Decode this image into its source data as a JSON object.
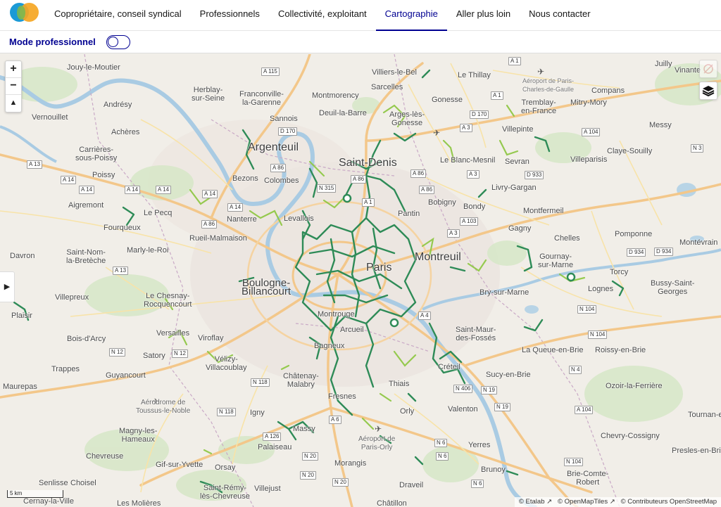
{
  "nav": {
    "items": [
      "Copropriétaire, conseil syndical",
      "Professionnels",
      "Collectivité, exploitant",
      "Cartographie",
      "Aller plus loin",
      "Nous contacter"
    ],
    "active": "Cartographie"
  },
  "mode": {
    "label": "Mode professionnel",
    "enabled": false
  },
  "colors": {
    "accent": "#000091",
    "network_dark": "#2e8b57",
    "network_light": "#8cc63f"
  },
  "map": {
    "zoom_in": "+",
    "zoom_out": "−",
    "north": "▲",
    "scale": "5 km",
    "attribution": [
      "© Etalab",
      "© OpenMapTiles",
      "© Contributeurs OpenStreetMap"
    ],
    "places": {
      "jouy": "Jouy-le-Moutier",
      "herblay": "Herblay-\nsur-Seine",
      "franconville": "Franconville-\nla-Garenne",
      "montmorency": "Montmorency",
      "villiers_bel": "Villiers-le-Bel",
      "thillay": "Le Thillay",
      "sarcelles": "Sarcelles",
      "gonesse": "Gonesse",
      "roissy_cdg": "Aéroport de Paris-\nCharles-de-Gaulle",
      "jully": "Juilly",
      "vinantes": "Vinante",
      "andresy": "Andrésy",
      "sannois": "Sannois",
      "deuil": "Deuil-la-Barre",
      "arnouville": "Arges-lès-\nGonesse",
      "tremblay": "Tremblay-\nen-France",
      "mitry": "Mitry-Mory",
      "compans": "Compans",
      "vernouillet": "Vernouillet",
      "acheres": "Achères",
      "messy": "Messy",
      "carrieres": "Carrières-\nsous-Poissy",
      "argenteuil": "Argenteuil",
      "villepinte": "Villepinte",
      "claye": "Claye-Souilly",
      "saint_denis": "Saint-Denis",
      "blanc_mesnil": "Le Blanc-Mesnil",
      "sevran": "Sevran",
      "villeparisis": "Villeparisis",
      "poissy": "Poissy",
      "bezons": "Bezons",
      "colombes": "Colombes",
      "livry": "Livry-Gargan",
      "aigremont": "Aigremont",
      "le_pecq": "Le Pecq",
      "bobigny": "Bobigny",
      "bondy": "Bondy",
      "montfermeil": "Montfermeil",
      "nanterre": "Nanterre",
      "levallois": "Levallois",
      "pantin": "Pantin",
      "fourqueux": "Fourqueux",
      "rueil": "Rueil-Malmaison",
      "gagny": "Gagny",
      "pomponne": "Pomponne",
      "chelles": "Chelles",
      "montevrain": "Montévrain",
      "davron": "Davron",
      "saint_nom": "Saint-Nom-\nla-Bretèche",
      "marly": "Marly-le-Roi",
      "paris": "Paris",
      "montreuil": "Montreuil",
      "gournay": "Gournay-\nsur-Marne",
      "torcy": "Torcy",
      "boulogne": "Boulogne-\nBillancourt",
      "chesnay": "Le Chesnay-\nRocquencourt",
      "bry": "Bry-sur-Marne",
      "lognes": "Lognes",
      "bussy": "Bussy-Saint-\nGeorges",
      "villepreux": "Villepreux",
      "plaisir": "Plaisir",
      "montrouge": "Montrouge",
      "saint_maur": "Saint-Maur-\ndes-Fossés",
      "versailles": "Versailles",
      "viroflay": "Viroflay",
      "arcueil": "Arcueil",
      "bois_arcy": "Bois-d'Arcy",
      "bagneux": "Bagneux",
      "queue_brie": "La Queue-en-Brie",
      "roissy_brie": "Roissy-en-Brie",
      "satory": "Satory",
      "velizy": "Vélizy-\nVillacoublay",
      "creteil": "Créteil",
      "trappes": "Trappes",
      "guyancourt": "Guyancourt",
      "chatenay": "Châtenay-\nMalabry",
      "thiais": "Thiais",
      "sucy": "Sucy-en-Brie",
      "ozoir": "Ozoir-la-Ferrière",
      "maurepas": "Maurepas",
      "fresnes": "Fresnes",
      "valenton": "Valenton",
      "aerodrome_toussus": "Aérodrome de\nToussus-le-Noble",
      "igny": "Igny",
      "orly": "Orly",
      "tournan": "Tournan-e",
      "magny": "Magny-les-\nHameaux",
      "massy": "Massy",
      "aeroport_orly": "Aéroport de\nParis-Orly",
      "chevry": "Chevry-Cossigny",
      "palaiseau": "Palaiseau",
      "yerres": "Yerres",
      "presles": "Presles-en-Brie",
      "chevreuse": "Chevreuse",
      "gif": "Gif-sur-Yvette",
      "orsay": "Orsay",
      "morangis": "Morangis",
      "brunoy": "Brunoy",
      "brie_comte": "Brie-Comte-\nRobert",
      "senlisse": "Senlisse",
      "choisel": "Choisel",
      "saint_remy": "Saint-Rémy-\nlès-Chevreuse",
      "villejust": "Villejust",
      "draveil": "Draveil",
      "cernay": "Cernay-la-Ville",
      "molieres": "Les Molières",
      "chatillon": "Châtillon"
    },
    "roads": {
      "a115": "A 115",
      "a1a": "A 1",
      "a1b": "A 1",
      "d170a": "D 170",
      "d170b": "D 170",
      "a104a": "A 104",
      "a3a": "A 3",
      "a3b": "A 3",
      "a3c": "A 3",
      "a13a": "A 13",
      "a86a": "A 86",
      "a86b": "A 86",
      "a86c": "A 86",
      "a86d": "A 86",
      "a86e": "A 86",
      "a14a": "A 14",
      "a14b": "A 14",
      "a14c": "A 14",
      "a14d": "A 14",
      "a14e": "A 14",
      "a14f": "A 14",
      "n3": "N 3",
      "d933": "D 933",
      "n315": "N 315",
      "a1c": "A 1",
      "a103": "A 103",
      "d934": "D 934",
      "d934b": "D 934",
      "a13b": "A 13",
      "a4": "A 4",
      "n104a": "N 104",
      "n104b": "N 104",
      "n12a": "N 12",
      "n12b": "N 12",
      "n4": "N 4",
      "n118a": "N 118",
      "n118b": "N 118",
      "n406": "N 406",
      "n19a": "N 19",
      "n19b": "N 19",
      "a104b": "A 104",
      "a6a": "A 6",
      "a126": "A 126",
      "n6a": "N 6",
      "n6b": "N 6",
      "n6c": "N 6",
      "n20a": "N 20",
      "n20b": "N 20",
      "n20c": "N 20",
      "n104c": "N 104"
    }
  }
}
